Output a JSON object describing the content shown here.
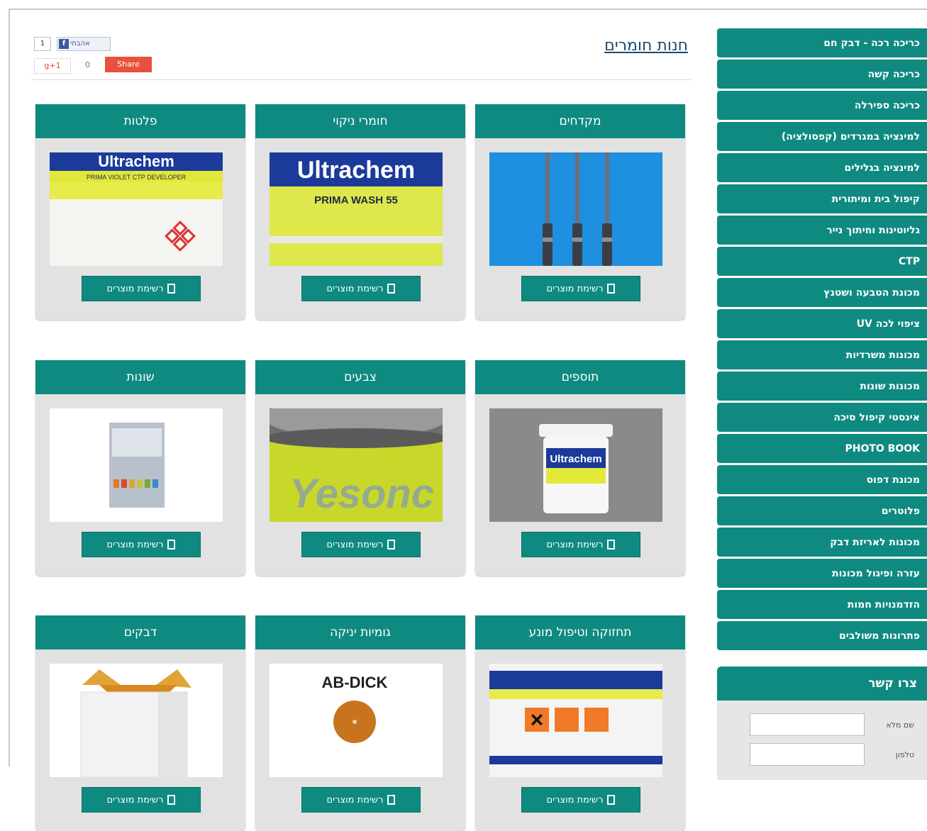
{
  "page": {
    "title": "חנות חומרים",
    "product_button_label": "רשימת מוצרים"
  },
  "social": {
    "fb_count": "1",
    "fb_like": "אהבתי",
    "gplus": "g+1",
    "gplus_count": "0",
    "share": "Share"
  },
  "sidebar": {
    "items": [
      {
        "label": "כריכה רכה - דבק חם"
      },
      {
        "label": "כריכה קשה"
      },
      {
        "label": "כריכה ספירלה"
      },
      {
        "label": "למינציה במגרדים (קפסולציה)"
      },
      {
        "label": "למינציה בגלילים"
      },
      {
        "label": "קיפול בית ומיתורית"
      },
      {
        "label": "גליוטינות וחיתוך נייר"
      },
      {
        "label": "CTP"
      },
      {
        "label": "מכונת הטבעה ושטנץ"
      },
      {
        "label": "ציפוי לכה UV"
      },
      {
        "label": "מכונות משרדיות"
      },
      {
        "label": "מכונות שונות"
      },
      {
        "label": "אינסטי קיפול סיכה"
      },
      {
        "label": "PHOTO BOOK"
      },
      {
        "label": "מכונת דפוס"
      },
      {
        "label": "פלוטרים"
      },
      {
        "label": "מכונות לאריזת דבק"
      },
      {
        "label": "עזרה ופיגול מכונות"
      },
      {
        "label": "הזדמנויות חמות"
      },
      {
        "label": "פתרונות משולבים"
      }
    ]
  },
  "contact": {
    "title": "צרו קשר",
    "name_label": "שם מלא",
    "phone_label": "טלפון"
  },
  "products": [
    {
      "title": "מקדחים",
      "image": "drill-bits"
    },
    {
      "title": "חומרי ניקוי",
      "image": "ultrachem-prima-wash",
      "brand": "Ultrachem",
      "product": "PRIMA WASH 55"
    },
    {
      "title": "פלטות",
      "image": "ultrachem-developer",
      "brand": "Ultrachem",
      "product": "PRIMA VIOLET CTP DEVELOPER"
    },
    {
      "title": "תוספים",
      "image": "ultrachem-tub",
      "brand": "Ultrachem"
    },
    {
      "title": "צבעים",
      "image": "ink-can",
      "brand": "Yesonc"
    },
    {
      "title": "שונות",
      "image": "sample-card"
    },
    {
      "title": "תחזוקה וטיפול מונע",
      "image": "hazard-box"
    },
    {
      "title": "גומיות יניקה",
      "image": "ab-dick-sucker",
      "brand": "AB-DICK"
    },
    {
      "title": "דבקים",
      "image": "white-box"
    }
  ],
  "colors": {
    "accent": "#0f8a80",
    "title": "#1a4a6e",
    "card_bg": "#e2e2e2"
  }
}
